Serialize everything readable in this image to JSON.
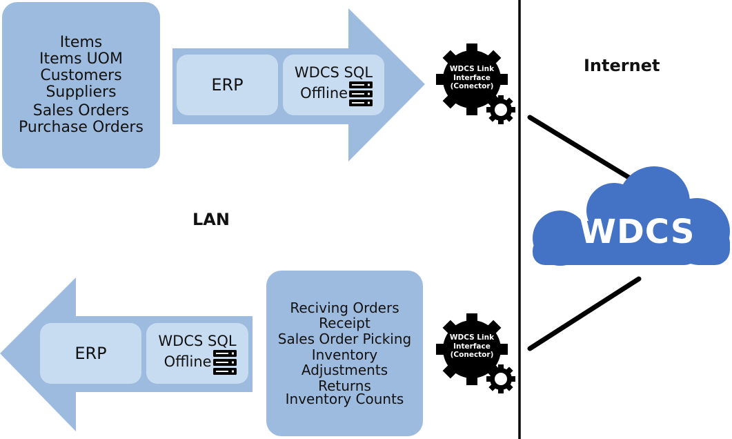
{
  "diagram": {
    "zones": {
      "lan_label": "LAN",
      "internet_label": "Internet"
    },
    "upload_data_box": {
      "lines": [
        "Items",
        "Items UOM",
        "Customers",
        "Suppliers",
        "Sales Orders",
        "Purchase Orders"
      ]
    },
    "upload_arrow": {
      "direction": "right",
      "erp_label": "ERP",
      "sql_line1": "WDCS SQL",
      "sql_line2": "Offline",
      "icon": "server-icon"
    },
    "download_data_box": {
      "lines": [
        "Reciving Orders",
        "Receipt",
        "Sales Order Picking",
        "Inventory",
        "Adjustments",
        "Returns",
        "Inventory Counts"
      ]
    },
    "download_arrow": {
      "direction": "left",
      "erp_label": "ERP",
      "sql_line1": "WDCS SQL",
      "sql_line2": "Offline",
      "icon": "server-icon"
    },
    "connectors": [
      {
        "line1": "WDCS Link",
        "line2": "Interface",
        "line3": "(Conector)",
        "icon": "gear-icon"
      },
      {
        "line1": "WDCS Link",
        "line2": "Interface",
        "line3": "(Conector)",
        "icon": "gear-icon"
      }
    ],
    "cloud": {
      "label": "WDCS",
      "icon": "cloud-icon"
    },
    "colors": {
      "box_fill": "#9dbbde",
      "inner_fill": "#c8dcf1",
      "cloud_fill": "#4472c4",
      "gear_fill": "#000000"
    }
  }
}
